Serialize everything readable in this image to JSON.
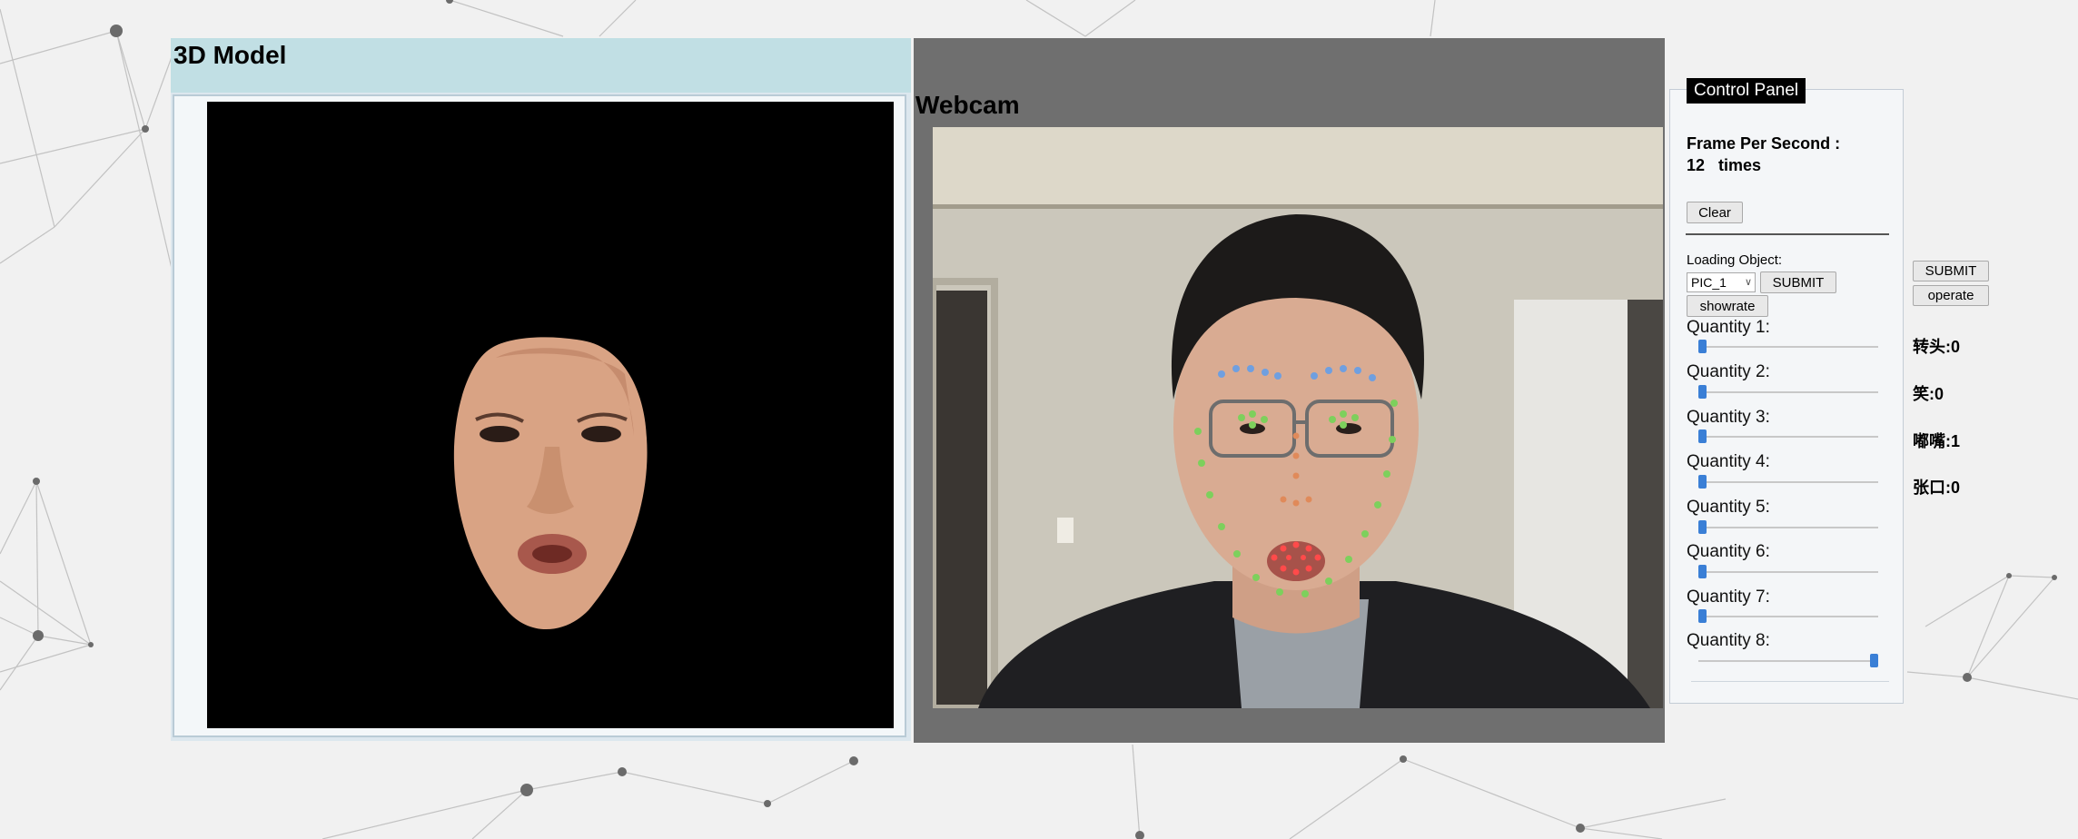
{
  "model": {
    "title": "3D Model"
  },
  "webcam": {
    "title": "Webcam"
  },
  "control_panel": {
    "title": "Control Panel",
    "fps_label": "Frame Per Second :",
    "fps_value": "12   times",
    "clear_label": "Clear",
    "loading_label": "Loading Object:",
    "select_value": "PIC_1",
    "submit_label": "SUBMIT",
    "showrate_label": "showrate",
    "quantities": [
      {
        "label": "Quantity 1:",
        "value": 0
      },
      {
        "label": "Quantity 2:",
        "value": 0
      },
      {
        "label": "Quantity 3:",
        "value": 0
      },
      {
        "label": "Quantity 4:",
        "value": 0
      },
      {
        "label": "Quantity 5:",
        "value": 0
      },
      {
        "label": "Quantity 6:",
        "value": 0
      },
      {
        "label": "Quantity 7:",
        "value": 0
      },
      {
        "label": "Quantity 8:",
        "value": 1
      }
    ]
  },
  "side": {
    "submit_label": "SUBMIT",
    "operate_label": "operate",
    "stats": [
      "转头:0",
      "笑:0",
      "嘟嘴:1",
      "张口:0"
    ]
  },
  "colors": {
    "slider_thumb": "#3a7fd6",
    "panel_header": "#c1dfe4",
    "webcam_bg": "#6f6f6f"
  }
}
